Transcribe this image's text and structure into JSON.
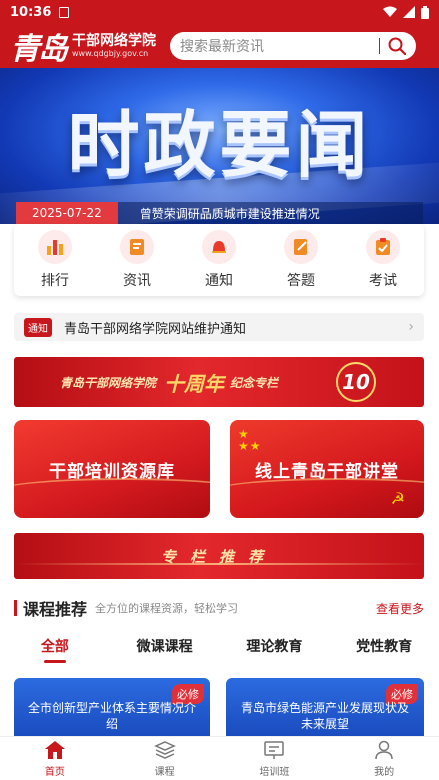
{
  "status": {
    "time": "10:36"
  },
  "header": {
    "logo_cn": "青岛",
    "logo_name": "干部网络学院",
    "logo_url": "www.qdgbjy.gov.cn",
    "search_placeholder": "搜索最新资讯"
  },
  "banner": {
    "title": "时政要闻",
    "date": "2025-07-22",
    "headline": "曾赞荣调研品质城市建设推进情况"
  },
  "quick": [
    {
      "label": "排行",
      "icon": "ranking-icon"
    },
    {
      "label": "资讯",
      "icon": "news-icon"
    },
    {
      "label": "通知",
      "icon": "bell-icon"
    },
    {
      "label": "答题",
      "icon": "quiz-icon"
    },
    {
      "label": "考试",
      "icon": "exam-icon"
    }
  ],
  "notice": {
    "tag": "通知",
    "text": "青岛干部网络学院网站维护通知",
    "arrow": "›"
  },
  "promos": {
    "anniv_left": "青岛干部网络学院",
    "anniv_mid": "十周年",
    "anniv_right": "纪念专栏",
    "anniv_badge": "10",
    "card_left": "干部培训资源库",
    "card_right": "线上青岛干部讲堂",
    "column": "专栏推荐"
  },
  "section": {
    "title": "课程推荐",
    "subtitle": "全方位的课程资源，轻松学习",
    "more": "查看更多"
  },
  "tabs": [
    "全部",
    "微课课程",
    "理论教育",
    "党性教育"
  ],
  "courses": [
    {
      "badge": "必修",
      "title": "全市创新型产业体系主要情况介绍"
    },
    {
      "badge": "必修",
      "title": "青岛市绿色能源产业发展现状及未来展望"
    }
  ],
  "tabbar": [
    {
      "label": "首页",
      "icon": "home-icon"
    },
    {
      "label": "课程",
      "icon": "layers-icon"
    },
    {
      "label": "培训班",
      "icon": "class-icon"
    },
    {
      "label": "我的",
      "icon": "user-icon"
    }
  ],
  "colors": {
    "brand": "#c8161d",
    "accent_blue": "#1a4cbf"
  }
}
